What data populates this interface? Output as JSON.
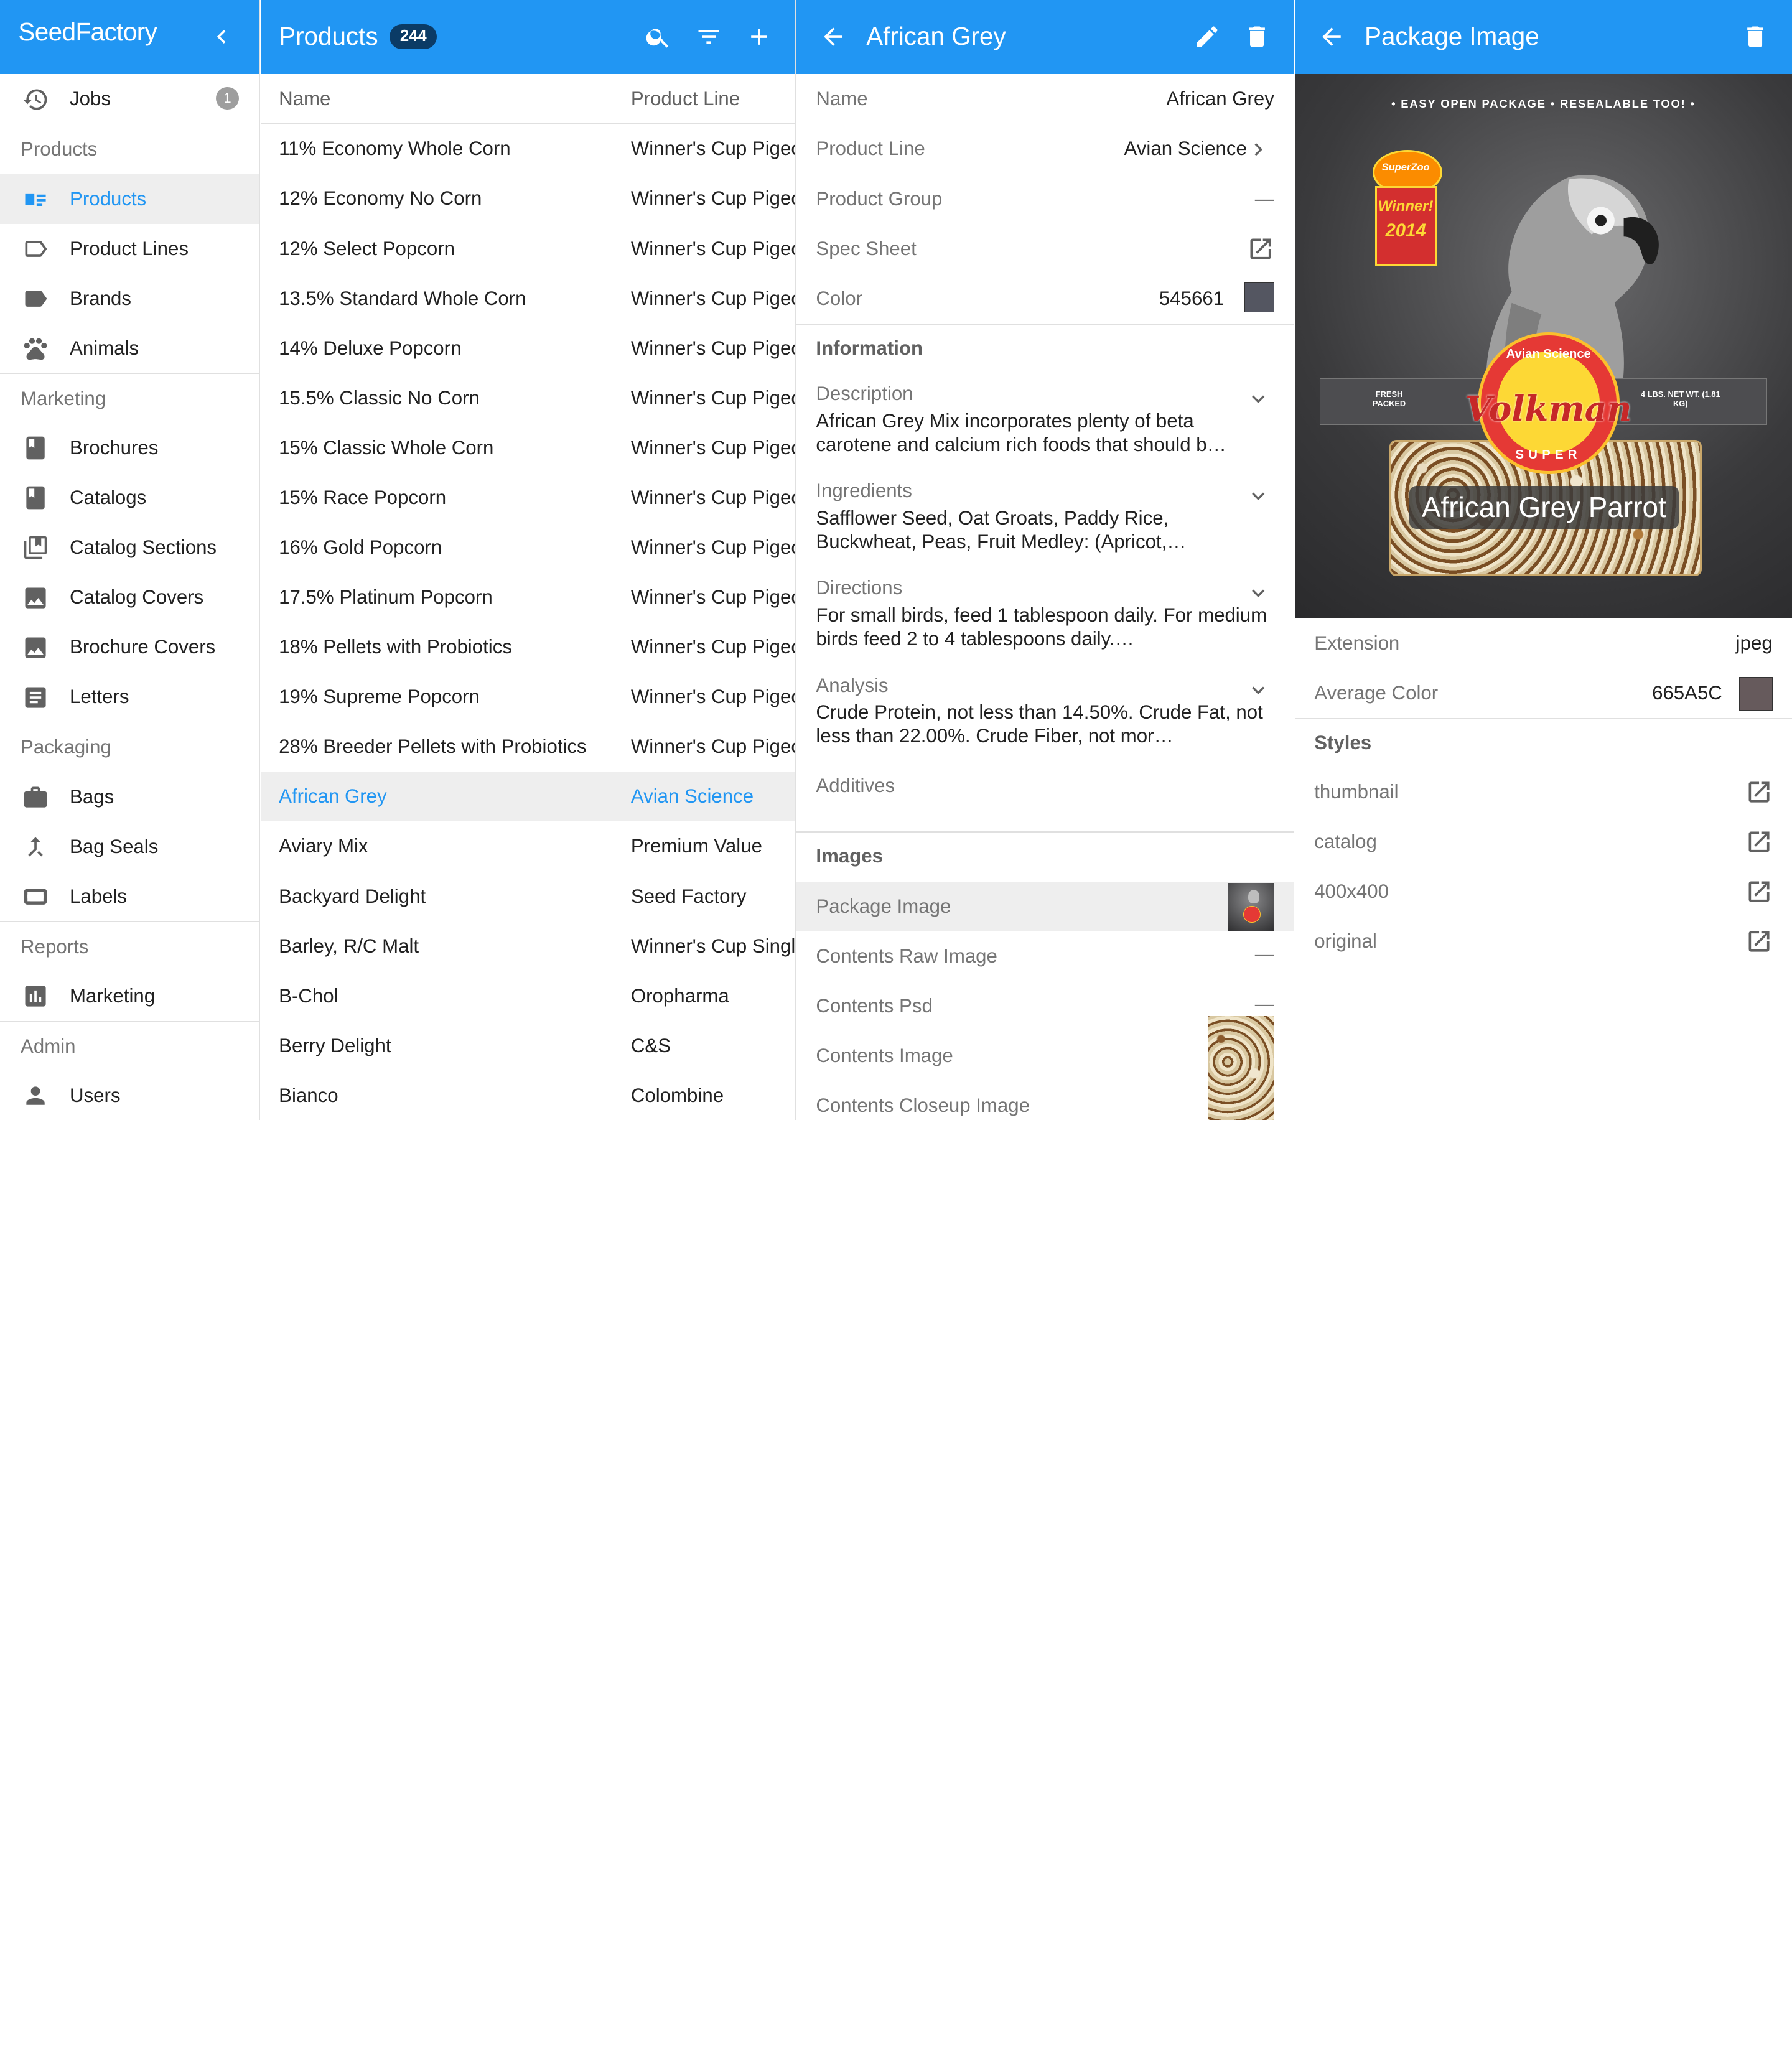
{
  "app": {
    "name": "SeedFactory",
    "jobs_label": "Jobs",
    "jobs_count": "1"
  },
  "sidebar": {
    "sections": [
      {
        "title": "Products",
        "items": [
          {
            "label": "Products",
            "icon": "product-card-icon",
            "active": true
          },
          {
            "label": "Product Lines",
            "icon": "label-outline-icon"
          },
          {
            "label": "Brands",
            "icon": "label-icon"
          },
          {
            "label": "Animals",
            "icon": "paw-icon"
          }
        ]
      },
      {
        "title": "Marketing",
        "items": [
          {
            "label": "Brochures",
            "icon": "book-icon"
          },
          {
            "label": "Catalogs",
            "icon": "book-icon"
          },
          {
            "label": "Catalog Sections",
            "icon": "library-icon"
          },
          {
            "label": "Catalog Covers",
            "icon": "image-icon"
          },
          {
            "label": "Brochure Covers",
            "icon": "image-icon"
          },
          {
            "label": "Letters",
            "icon": "article-icon"
          }
        ]
      },
      {
        "title": "Packaging",
        "items": [
          {
            "label": "Bags",
            "icon": "briefcase-icon"
          },
          {
            "label": "Bag Seals",
            "icon": "merge-icon"
          },
          {
            "label": "Labels",
            "icon": "label-rect-icon"
          }
        ]
      },
      {
        "title": "Reports",
        "items": [
          {
            "label": "Marketing",
            "icon": "bar-chart-icon"
          }
        ]
      },
      {
        "title": "Admin",
        "items": [
          {
            "label": "Users",
            "icon": "person-icon"
          }
        ]
      }
    ]
  },
  "products": {
    "title": "Products",
    "count": "244",
    "columns": [
      "Name",
      "Product Line"
    ],
    "rows": [
      {
        "name": "11% Economy Whole Corn",
        "line": "Winner's Cup Pigeon"
      },
      {
        "name": "12% Economy No Corn",
        "line": "Winner's Cup Pigeon"
      },
      {
        "name": "12% Select Popcorn",
        "line": "Winner's Cup Pigeon"
      },
      {
        "name": "13.5% Standard Whole Corn",
        "line": "Winner's Cup Pigeon"
      },
      {
        "name": "14% Deluxe Popcorn",
        "line": "Winner's Cup Pigeon"
      },
      {
        "name": "15.5% Classic No Corn",
        "line": "Winner's Cup Pigeon"
      },
      {
        "name": "15% Classic Whole Corn",
        "line": "Winner's Cup Pigeon"
      },
      {
        "name": "15% Race Popcorn",
        "line": "Winner's Cup Pigeon"
      },
      {
        "name": "16% Gold Popcorn",
        "line": "Winner's Cup Pigeon"
      },
      {
        "name": "17.5% Platinum Popcorn",
        "line": "Winner's Cup Pigeon"
      },
      {
        "name": "18% Pellets with Probiotics",
        "line": "Winner's Cup Pigeon"
      },
      {
        "name": "19% Supreme Popcorn",
        "line": "Winner's Cup Pigeon"
      },
      {
        "name": "28% Breeder Pellets with Probiotics",
        "line": "Winner's Cup Pigeon"
      },
      {
        "name": "African Grey",
        "line": "Avian Science",
        "selected": true
      },
      {
        "name": "Aviary Mix",
        "line": "Premium Value"
      },
      {
        "name": "Backyard Delight",
        "line": "Seed Factory"
      },
      {
        "name": "Barley, R/C Malt",
        "line": "Winner's Cup Single"
      },
      {
        "name": "B-Chol",
        "line": "Oropharma"
      },
      {
        "name": "Berry Delight",
        "line": "C&S"
      },
      {
        "name": "Bianco",
        "line": "Colombine"
      }
    ]
  },
  "detail": {
    "title": "African Grey",
    "fields": {
      "name_label": "Name",
      "name_value": "African Grey",
      "line_label": "Product Line",
      "line_value": "Avian Science",
      "group_label": "Product Group",
      "group_value": "—",
      "spec_label": "Spec Sheet",
      "color_label": "Color",
      "color_value": "545661",
      "color_hex": "#545661"
    },
    "information_title": "Information",
    "information": [
      {
        "label": "Description",
        "text": "African Grey Mix incorporates plenty of beta carotene and calcium rich foods that should b…"
      },
      {
        "label": "Ingredients",
        "text": "Safflower Seed, Oat Groats, Paddy Rice, Buckwheat, Peas, Fruit Medley: (Apricot, Nectarine…"
      },
      {
        "label": "Directions",
        "text": "For small birds, feed 1 tablespoon daily. For medium birds feed 2 to 4 tablespoons daily.…"
      },
      {
        "label": "Analysis",
        "text": "Crude Protein, not less than 14.50%. Crude Fat, not less than 22.00%. Crude Fiber, not mor…"
      }
    ],
    "additives_label": "Additives",
    "images_title": "Images",
    "images": {
      "package": "Package Image",
      "contents_raw": "Contents Raw Image",
      "contents_raw_value": "—",
      "contents_psd": "Contents Psd",
      "contents_psd_value": "—",
      "contents_image": "Contents Image",
      "contents_closeup": "Contents Closeup Image"
    }
  },
  "package_image": {
    "title": "Package Image",
    "bag": {
      "top_text": "• EASY OPEN PACKAGE • RESEALABLE TOO! •",
      "award_line1": "SuperZoo",
      "award_line2": "Winner!",
      "award_year": "2014",
      "fresh": "FRESH PACKED",
      "weight": "4 LBS. NET WT. (1.81 KG)",
      "brand_top": "Avian Science",
      "brand": "Volkman",
      "brand_bottom": "SUPER",
      "product": "African Grey Parrot"
    },
    "extension_label": "Extension",
    "extension_value": "jpeg",
    "avg_color_label": "Average Color",
    "avg_color_value": "665A5C",
    "avg_color_hex": "#665A5C",
    "styles_title": "Styles",
    "styles": [
      "thumbnail",
      "catalog",
      "400x400",
      "original"
    ]
  },
  "colors": {
    "primary": "#2196F3",
    "badge_dark": "#0B3B66"
  }
}
